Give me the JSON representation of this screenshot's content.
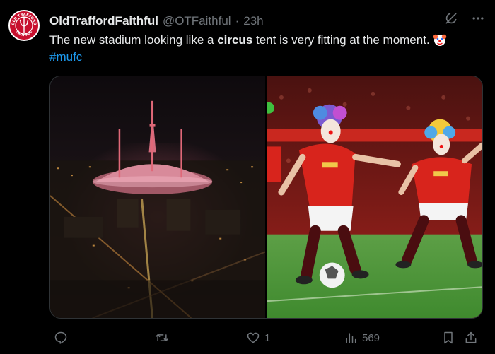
{
  "tweet": {
    "display_name": "OldTraffordFaithful",
    "handle": "@OTFaithful",
    "separator": "·",
    "time": "23h",
    "text_before": "The new stadium looking like a ",
    "text_bold": "circus",
    "text_after": " tent is very fitting at the moment.",
    "hashtag": "#mufc",
    "emoji": "clown-face-emoji"
  },
  "avatar": {
    "ring_text_top": "OLD TRAFFORD",
    "ring_text_bottom": "FAITHFUL",
    "color": "#c8102e"
  },
  "actions": {
    "reply_count": "",
    "retweet_count": "",
    "like_count": "1",
    "views_count": "569"
  },
  "icons": {
    "grok": "grok-icon",
    "more": "more-icon",
    "reply": "reply-icon",
    "retweet": "retweet-icon",
    "like": "heart-icon",
    "views": "views-icon",
    "bookmark": "bookmark-icon",
    "share": "share-icon"
  },
  "colors": {
    "background": "#000000",
    "text": "#e7e9ea",
    "muted": "#71767b",
    "link": "#1d9bf0"
  }
}
